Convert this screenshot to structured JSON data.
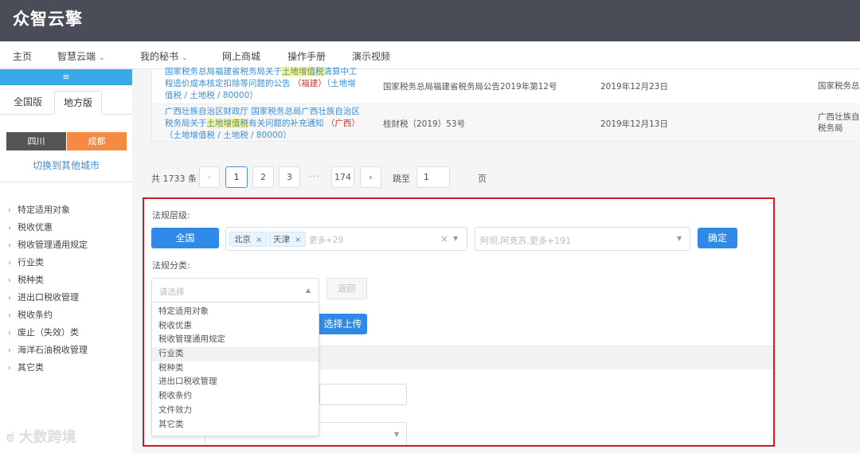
{
  "app": {
    "logo": "众智云擎"
  },
  "nav": {
    "items": [
      {
        "label": "主页",
        "caret": ""
      },
      {
        "label": "智慧云端",
        "caret": "⌄"
      },
      {
        "label": "我的秘书",
        "caret": "⌄"
      },
      {
        "label": "网上商城",
        "caret": ""
      },
      {
        "label": "操作手册",
        "caret": ""
      },
      {
        "label": "演示视频",
        "caret": ""
      }
    ]
  },
  "sidebar": {
    "menu_glyph": "≡",
    "tabs": [
      "全国版",
      "地方版"
    ],
    "cities": [
      "四川",
      "成都"
    ],
    "switch_city": "切换到其他城市",
    "categories": [
      "特定适用对象",
      "税收优惠",
      "税收管理通用规定",
      "行业类",
      "税种类",
      "进出口税收管理",
      "税收条约",
      "废止（失效）类",
      "海洋石油税收管理",
      "其它类"
    ]
  },
  "results": [
    {
      "title_pre": "国家税务总局福建省税务局关于",
      "highlight": "土地增值税",
      "title_post": "清算中工程造价成本核定扣除等问题的公告",
      "region": "（福建）",
      "tail": "（土地增值税 / 土地税 / 80000）",
      "doc_no": "国家税务总局福建省税务局公告2019年第12号",
      "date": "2019年12月23日",
      "source": "国家税务总局"
    },
    {
      "title_pre": "广西壮族自治区财政厅 国家税务总局广西壮族自治区税务局关于",
      "highlight": "土地增值税",
      "title_post": "有关问题的补充通知",
      "region": "（广西）",
      "tail": "（土地增值税 / 土地税 / 80000）",
      "doc_no": "桂财税（2019）53号",
      "date": "2019年12月13日",
      "source": "广西壮族自治区",
      "source_line2": "税务局"
    }
  ],
  "pager": {
    "total": "共 1733 条",
    "prev": "‹",
    "pages": [
      "1",
      "2",
      "3"
    ],
    "dots": "···",
    "last": "174",
    "next": "›",
    "jump_label": "跳至",
    "jump_value": "1",
    "page_unit": "页"
  },
  "filter": {
    "level_label": "法规层级:",
    "national_button": "全国",
    "tags": [
      "北京",
      "天津"
    ],
    "tag_remove": "×",
    "more_tags": "更多+29",
    "clear": "×",
    "second_placeholder": "阿坝,阿克苏,更多+191",
    "confirm": "确定",
    "category_label": "法规分类:",
    "category_placeholder": "请选择",
    "back": "返回",
    "upload": "选择上传",
    "options": [
      "特定适用对象",
      "税收优惠",
      "税收管理通用规定",
      "行业类",
      "税种类",
      "进出口税收管理",
      "税收条约",
      "文件效力",
      "其它类"
    ]
  },
  "watermark": "大数跨境",
  "colors": {
    "topbar": "#4a4d57",
    "accent": "#2e8ae6",
    "highlight": "#fff37a",
    "frame": "#d7191b",
    "city_active": "#f58a43"
  }
}
